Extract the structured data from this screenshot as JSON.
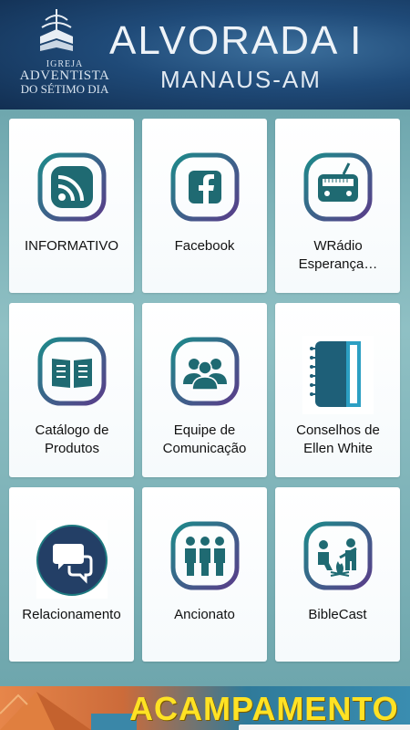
{
  "header": {
    "church_line1": "IGREJA",
    "church_line2": "ADVENTISTA",
    "church_line3": "DO SÉTIMO DIA",
    "title": "ALVORADA I",
    "subtitle": "MANAUS-AM"
  },
  "tiles": [
    {
      "label": "INFORMATIVO",
      "icon": "rss-icon"
    },
    {
      "label": "Facebook",
      "icon": "facebook-icon"
    },
    {
      "label": "WRádio Esperança…",
      "icon": "radio-icon"
    },
    {
      "label": "Catálogo de Produtos",
      "icon": "book-icon"
    },
    {
      "label": "Equipe de Comunicação",
      "icon": "team-icon"
    },
    {
      "label": "Conselhos de Ellen White",
      "icon": "notebook-icon"
    },
    {
      "label": "Relacionamento",
      "icon": "chat-icon"
    },
    {
      "label": "Ancionato",
      "icon": "elders-icon"
    },
    {
      "label": "BibleCast",
      "icon": "campfire-icon"
    }
  ],
  "banner": {
    "text": "ACAMPAMENTO"
  },
  "colors": {
    "icon_teal": "#1d6f73",
    "icon_gradient_end": "#7a3a8a",
    "header_blue": "#1f4a78",
    "banner_yellow": "#ffe224"
  }
}
